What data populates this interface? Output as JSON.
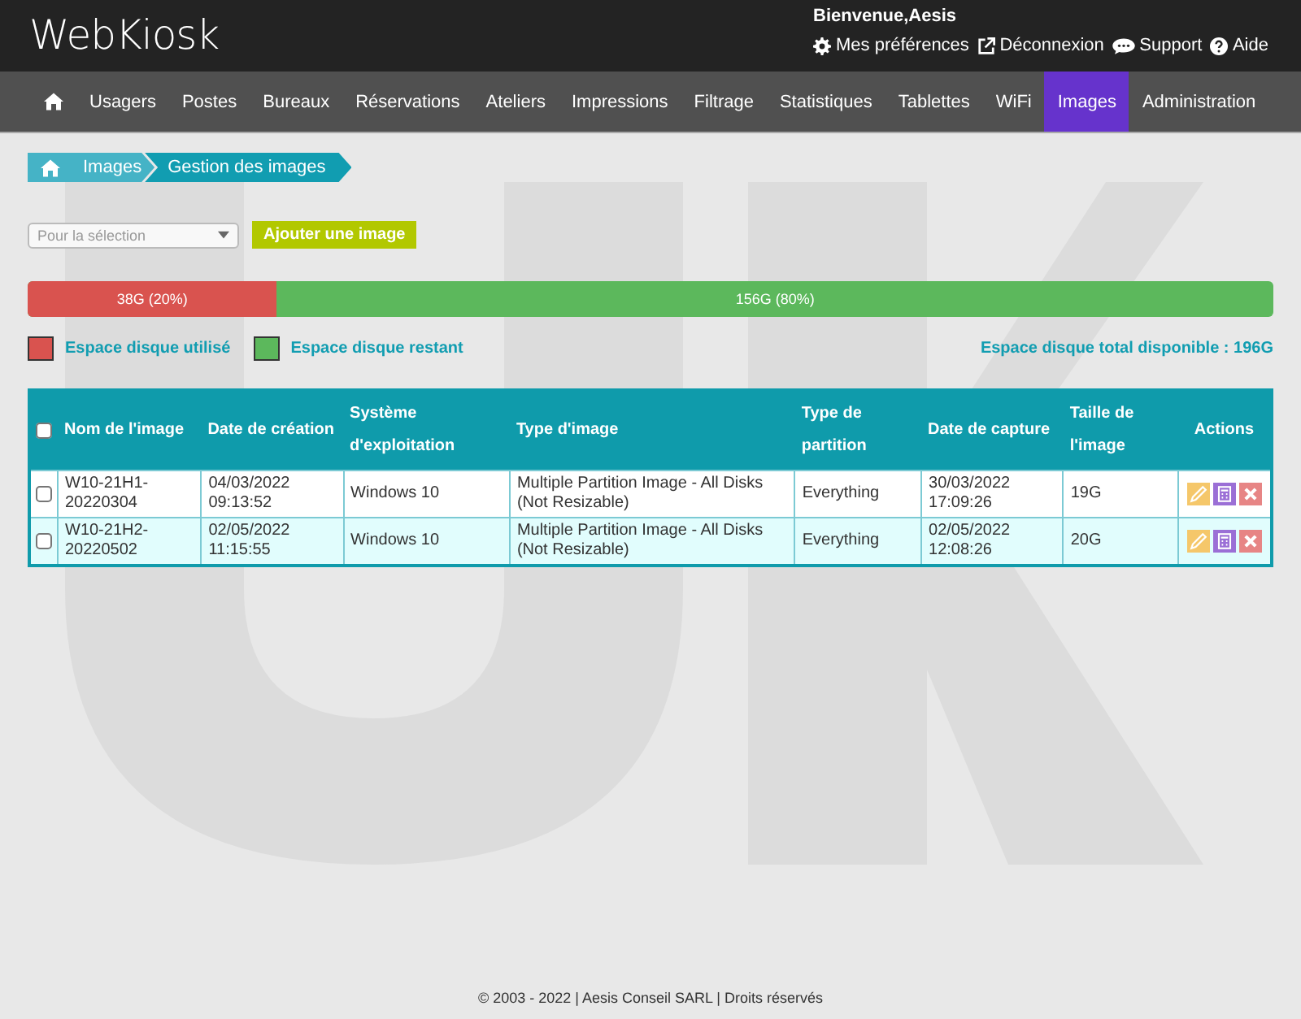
{
  "header": {
    "logo": "WebKiosk",
    "welcome": "Bienvenue,Aesis",
    "links": [
      {
        "kind": "gear",
        "label": "Mes préférences"
      },
      {
        "kind": "external",
        "label": "Déconnexion"
      },
      {
        "kind": "chat",
        "label": "Support"
      },
      {
        "kind": "help",
        "label": "Aide"
      }
    ]
  },
  "nav": [
    {
      "kind": "home",
      "selected": false
    },
    {
      "label": "Usagers",
      "selected": false
    },
    {
      "label": "Postes",
      "selected": false
    },
    {
      "label": "Bureaux",
      "selected": false
    },
    {
      "label": "Réservations",
      "selected": false
    },
    {
      "label": "Ateliers",
      "selected": false
    },
    {
      "label": "Impressions",
      "selected": false
    },
    {
      "label": "Filtrage",
      "selected": false
    },
    {
      "label": "Statistiques",
      "selected": false
    },
    {
      "label": "Tablettes",
      "selected": false
    },
    {
      "label": "WiFi",
      "selected": false
    },
    {
      "label": "Images",
      "selected": true
    },
    {
      "label": "Administration",
      "selected": false
    }
  ],
  "breadcrumb": [
    "Images",
    "Gestion des images"
  ],
  "toolbar": {
    "select": {
      "placeholder": "Pour la sélection"
    },
    "add_button": "Ajouter une image"
  },
  "disk": {
    "used": {
      "label": "38G (20%)",
      "level": 0.2,
      "color": "#d9534f"
    },
    "free": {
      "label": "156G (80%)",
      "color": "#5cb85c"
    },
    "legend": [
      {
        "label": "Espace disque utilisé",
        "color": "#d9534f"
      },
      {
        "label": "Espace disque restant",
        "color": "#5cb85c"
      }
    ],
    "total": "Espace disque total disponible : 196G"
  },
  "table": {
    "all_checked": false,
    "columns": [
      "Nom de l'image",
      "Date de création",
      "Système d'exploitation",
      "Type d'image",
      "Type de partition",
      "Date de capture",
      "Taille de l'image",
      "Actions"
    ],
    "rows": [
      {
        "checked": false,
        "cells": [
          "W10-21H1-20220304",
          "04/03/2022 09:13:52",
          "Windows 10",
          "Multiple Partition Image - All Disks (Not Resizable)",
          "Everything",
          "30/03/2022 17:09:26",
          "19G"
        ]
      },
      {
        "checked": false,
        "cells": [
          "W10-21H2-20220502",
          "02/05/2022 11:15:55",
          "Windows 10",
          "Multiple Partition Image - All Disks (Not Resizable)",
          "Everything",
          "02/05/2022 12:08:26",
          "20G"
        ]
      }
    ]
  },
  "footer": "© 2003 - 2022 | Aesis Conseil SARL | Droits réservés"
}
